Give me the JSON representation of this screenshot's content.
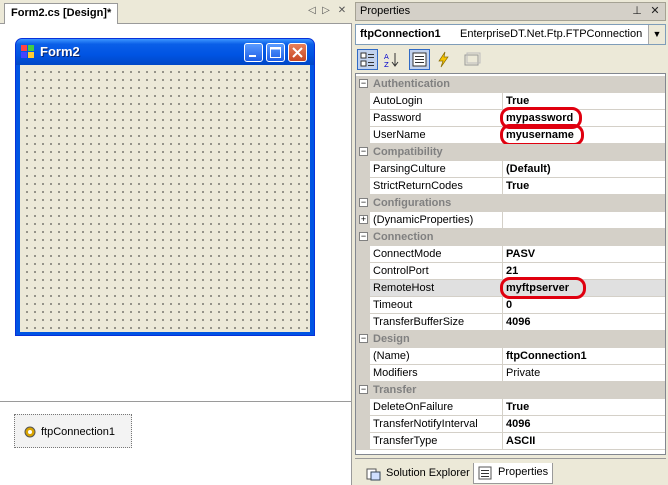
{
  "designer": {
    "tab_label": "Form2.cs [Design]*",
    "form": {
      "title": "Form2"
    },
    "tray": {
      "component_label": "ftpConnection1"
    }
  },
  "properties": {
    "title": "Properties",
    "selector": {
      "name": "ftpConnection1",
      "type": "EnterpriseDT.Net.Ftp.FTPConnection"
    },
    "categories": [
      {
        "label": "Authentication",
        "rows": [
          {
            "name": "AutoLogin",
            "value": "True"
          },
          {
            "name": "Password",
            "value": "mypassword"
          },
          {
            "name": "UserName",
            "value": "myusername"
          }
        ]
      },
      {
        "label": "Compatibility",
        "rows": [
          {
            "name": "ParsingCulture",
            "value": "(Default)"
          },
          {
            "name": "StrictReturnCodes",
            "value": "True"
          }
        ]
      },
      {
        "label": "Configurations",
        "rows": [
          {
            "name": "(DynamicProperties)",
            "value": ""
          }
        ]
      },
      {
        "label": "Connection",
        "rows": [
          {
            "name": "ConnectMode",
            "value": "PASV"
          },
          {
            "name": "ControlPort",
            "value": "21"
          },
          {
            "name": "RemoteHost",
            "value": "myftpserver"
          },
          {
            "name": "Timeout",
            "value": "0"
          },
          {
            "name": "TransferBufferSize",
            "value": "4096"
          }
        ]
      },
      {
        "label": "Design",
        "rows": [
          {
            "name": "(Name)",
            "value": "ftpConnection1"
          },
          {
            "name": "Modifiers",
            "value": "Private"
          }
        ]
      },
      {
        "label": "Transfer",
        "rows": [
          {
            "name": "DeleteOnFailure",
            "value": "True"
          },
          {
            "name": "TransferNotifyInterval",
            "value": "4096"
          },
          {
            "name": "TransferType",
            "value": "ASCII"
          }
        ]
      }
    ]
  },
  "bottom_tabs": {
    "solution_explorer": "Solution Explorer",
    "properties": "Properties"
  },
  "colors": {
    "highlight_circle": "#e0000f",
    "xp_title_blue": "#0054e3",
    "panel": "#ece9d8"
  }
}
